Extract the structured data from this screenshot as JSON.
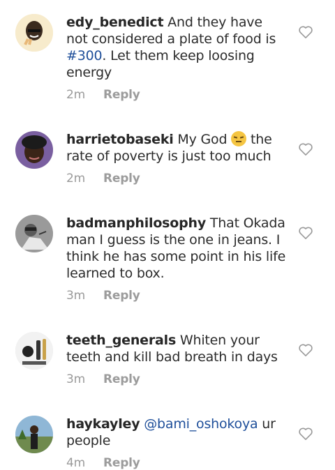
{
  "comments": [
    {
      "username": "edy_benedict",
      "text_before": " And they have not considered a plate of food is ",
      "link": "#300",
      "text_after": ". Let them keep loosing energy",
      "time": "2m",
      "reply_label": "Reply"
    },
    {
      "username": "harrietobaseki",
      "text_before": " My God ",
      "emoji": "unamused-face",
      "text_after": " the rate of poverty is just too much",
      "time": "2m",
      "reply_label": "Reply"
    },
    {
      "username": "badmanphilosophy",
      "text": " That Okada man I guess is the one in jeans. I think he has some point in his life learned to box.",
      "time": "3m",
      "reply_label": "Reply"
    },
    {
      "username": "teeth_generals",
      "text": " Whiten your teeth and kill bad breath in days",
      "time": "3m",
      "reply_label": "Reply"
    },
    {
      "username": "haykayley",
      "mention": "@bami_oshokoya",
      "text": "  ur people",
      "time": "4m",
      "reply_label": "Reply"
    }
  ],
  "colors": {
    "link": "#1f4f9a",
    "meta": "#9a9a9a",
    "text": "#2b2b2b"
  },
  "icons": [
    "avatar",
    "heart-outline-icon",
    "unamused-face-emoji"
  ]
}
